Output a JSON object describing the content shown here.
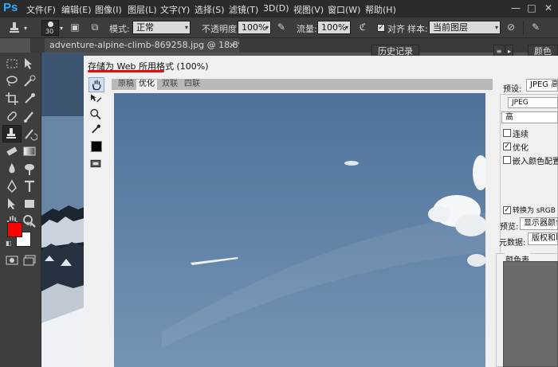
{
  "app": {
    "logo": "Ps"
  },
  "menubar": {
    "items": [
      "文件(F)",
      "编辑(E)",
      "图像(I)",
      "图层(L)",
      "文字(Y)",
      "选择(S)",
      "滤镜(T)",
      "3D(D)",
      "视图(V)",
      "窗口(W)",
      "帮助(H)"
    ],
    "window_controls": [
      "—",
      "□",
      "✕"
    ]
  },
  "optionsbar": {
    "brush_size": "30",
    "mode_label": "模式:",
    "mode_value": "正常",
    "opacity_label": "不透明度:",
    "opacity_value": "100%",
    "flow_label": "流量:",
    "flow_value": "100%",
    "aligned_label": "对齐",
    "aligned_checked": "✓",
    "sample_label": "样本:",
    "sample_value": "当前图层"
  },
  "document": {
    "tab_title": "adventure-alpine-climb-869258.jpg @ 18.8%(RGB/8) *",
    "tab_close": "×"
  },
  "panels": {
    "history_tab": "历史记录",
    "color_tab": "颜色"
  },
  "dialog": {
    "title": "存储为 Web 所用格式 (100%)",
    "view_tabs": [
      "原稿",
      "优化",
      "双联",
      "四联"
    ],
    "preset_label": "预设:",
    "preset_value": "JPEG 高",
    "format_value": "JPEG",
    "quality_value": "高",
    "options": [
      {
        "label": "连续",
        "checked": ""
      },
      {
        "label": "优化",
        "checked": "✓"
      },
      {
        "label": "嵌入颜色配置文",
        "checked": ""
      }
    ],
    "convert_srgb": {
      "label": "转换为 sRGB",
      "checked": "✓"
    },
    "preview_label": "预览:",
    "preview_value": "显示器颜色",
    "metadata_label": "元数据:",
    "metadata_value": "版权和联系",
    "color_table_label": "颜色表"
  },
  "colors": {
    "foreground": "#ff0000",
    "background": "#ffffff",
    "sky": "#5e7fa0",
    "underline": "#e01010"
  }
}
